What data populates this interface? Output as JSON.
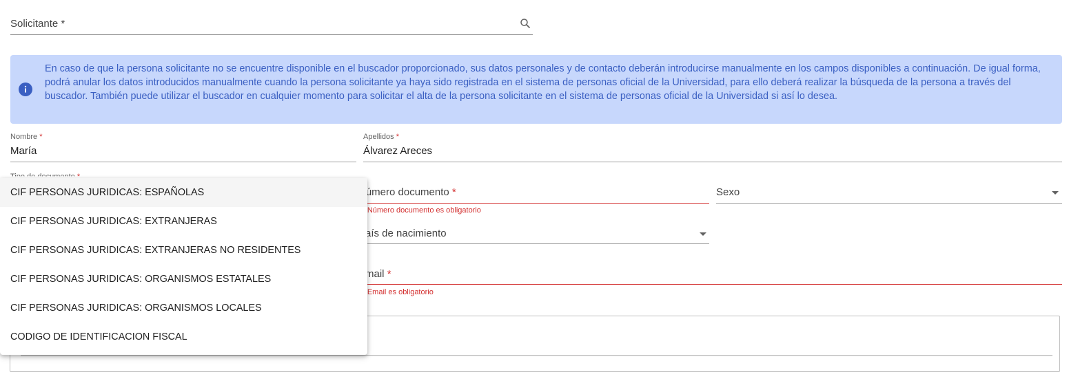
{
  "solicitante": {
    "label": "Solicitante",
    "required_mark": "*"
  },
  "info_banner": {
    "text": "En caso de que la persona solicitante no se encuentre disponible en el buscador proporcionado, sus datos personales y de contacto deberán introducirse manualmente en los campos disponibles a continuación. De igual forma, podrá anular los datos introducidos manualmente cuando la persona solicitante ya haya sido registrada en el sistema de personas oficial de la Universidad, para ello deberá realizar la búsqueda de la persona a través del buscador. También puede utilizar el buscador en cualquier momento para solicitar el alta de la persona solicitante en el sistema de personas oficial de la Universidad si así lo desea.",
    "icon": "info-icon",
    "colors": {
      "background": "#c7d7fc",
      "text": "#3a5fc2"
    }
  },
  "nombre": {
    "label": "Nombre",
    "required_mark": "*",
    "value": "María"
  },
  "apellidos": {
    "label": "Apellidos",
    "required_mark": "*",
    "value": "Álvarez Areces"
  },
  "tipo_documento": {
    "label": "Tipo de documento",
    "required_mark": "*"
  },
  "numero_documento": {
    "label": "Número documento",
    "required_mark": "*",
    "error": "El Número documento es obligatorio"
  },
  "sexo": {
    "label": "Sexo"
  },
  "pais_nacimiento": {
    "label": "País de nacimiento"
  },
  "email": {
    "label": "Email",
    "required_mark": "*",
    "error": "El Email es obligatorio"
  },
  "dropdown": {
    "options": [
      "CIF PERSONAS JURIDICAS: ESPAÑOLAS",
      "CIF PERSONAS JURIDICAS: EXTRANJERAS",
      "CIF PERSONAS JURIDICAS: EXTRANJERAS NO RESIDENTES",
      "CIF PERSONAS JURIDICAS: ORGANISMOS ESTATALES",
      "CIF PERSONAS JURIDICAS: ORGANISMOS LOCALES",
      "CODIGO DE IDENTIFICACION FISCAL"
    ],
    "active_index": 0
  },
  "colors": {
    "error": "#d32f2f",
    "accent": "#3a5fc2"
  }
}
